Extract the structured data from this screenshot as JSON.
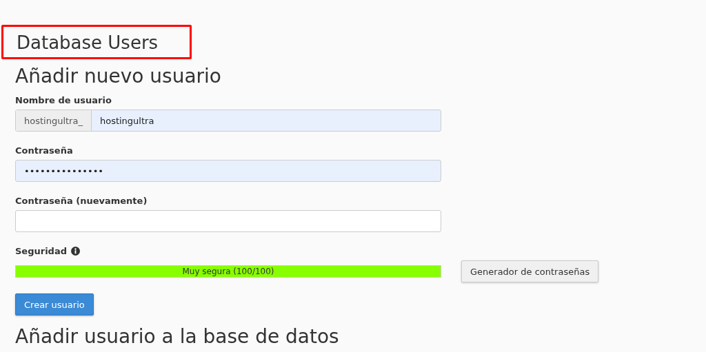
{
  "page_title": {
    "text": "Database Users",
    "highlighted": true
  },
  "section": {
    "heading": "Añadir nuevo usuario",
    "username": {
      "label": "Nombre de usuario",
      "prefix": "hostingultra_",
      "value": "hostingultra"
    },
    "password": {
      "label": "Contraseña",
      "value": "•••••••••••••••"
    },
    "password_again": {
      "label": "Contraseña (nuevamente)"
    },
    "strength": {
      "label": "Seguridad",
      "level": 1,
      "reading": "Muy segura (100/100)"
    },
    "generator_button": "Generador de contraseñas",
    "submit_button": "Crear usuario"
  },
  "next_section": {
    "heading": "Añadir usuario a la base de datos"
  }
}
